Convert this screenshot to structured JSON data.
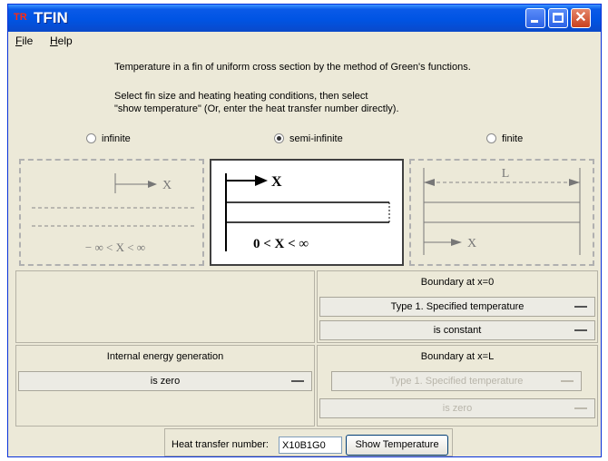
{
  "window": {
    "app_icon": "TR",
    "title": "TFIN",
    "controls": {
      "minimize": "minimize-icon",
      "maximize": "maximize-icon",
      "close": "✕"
    }
  },
  "menu": {
    "file": "File",
    "help": "Help"
  },
  "intro": {
    "line1": "Temperature in a fin of uniform cross section by the method of Green's functions.",
    "line2": "Select fin size and heating heating conditions, then select",
    "line3": "\"show temperature\"  (Or, enter the heat transfer number directly)."
  },
  "fin_size": {
    "options": [
      "infinite",
      "semi-infinite",
      "finite"
    ],
    "selected": "semi-infinite"
  },
  "diagrams": {
    "infinite": {
      "axis": "X",
      "range": "− ∞  < X < ∞"
    },
    "semi_infinite": {
      "axis": "X",
      "range": "0 < X <  ∞"
    },
    "finite": {
      "length": "L",
      "axis": "X"
    }
  },
  "boundary0": {
    "heading": "Boundary at x=0",
    "type": "Type 1.  Specified temperature",
    "condition": "is constant"
  },
  "generation": {
    "heading": "Internal energy generation",
    "value": "is zero"
  },
  "boundaryL": {
    "heading": "Boundary at x=L",
    "type": "Type 1.  Specified temperature",
    "condition": "is zero",
    "enabled": false
  },
  "footer": {
    "label": "Heat transfer number:",
    "value": "X10B1G0",
    "button": "Show Temperature"
  },
  "colors": {
    "titlebar": "#0054e3",
    "face": "#ece9d8",
    "close": "#c8401e"
  }
}
